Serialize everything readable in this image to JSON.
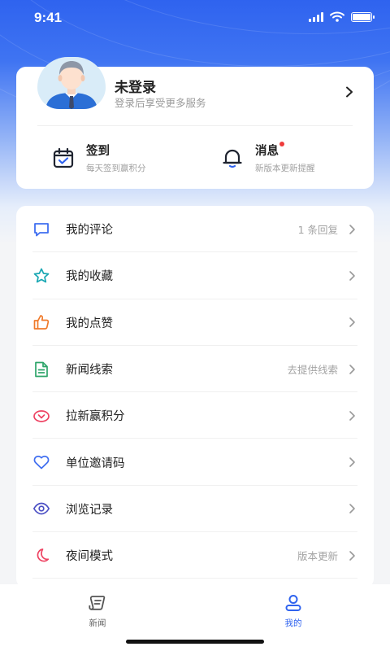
{
  "status_bar": {
    "time": "9:41"
  },
  "profile": {
    "title": "未登录",
    "subtitle": "登录后享受更多服务"
  },
  "quick_actions": [
    {
      "title": "签到",
      "subtitle": "每天签到赢积分",
      "icon": "calendar-check-icon"
    },
    {
      "title": "消息",
      "subtitle": "新版本更新提醒",
      "icon": "bell-icon"
    }
  ],
  "menu": [
    {
      "label": "我的评论",
      "right": "1 条回复",
      "icon": "comment-icon",
      "color": "#3f6ef0"
    },
    {
      "label": "我的收藏",
      "right": "",
      "icon": "star-icon",
      "color": "#19a7b3"
    },
    {
      "label": "我的点赞",
      "right": "",
      "icon": "thumbs-up-icon",
      "color": "#f07a2a"
    },
    {
      "label": "新闻线索",
      "right": "去提供线索",
      "icon": "document-icon",
      "color": "#2ea56a"
    },
    {
      "label": "拉新赢积分",
      "right": "",
      "icon": "gift-icon",
      "color": "#ee4262"
    },
    {
      "label": "单位邀请码",
      "right": "",
      "icon": "heart-icon",
      "color": "#3f6ef0"
    },
    {
      "label": "浏览记录",
      "right": "",
      "icon": "eye-icon",
      "color": "#4b4fc4"
    },
    {
      "label": "夜间模式",
      "right": "版本更新",
      "icon": "moon-icon",
      "color": "#ee4262"
    }
  ],
  "tabs": [
    {
      "label": "新闻",
      "icon": "news-icon",
      "active": false
    },
    {
      "label": "我的",
      "icon": "profile-icon",
      "active": true
    }
  ],
  "colors": {
    "accent": "#2f63ef",
    "inactive": "#666666"
  }
}
